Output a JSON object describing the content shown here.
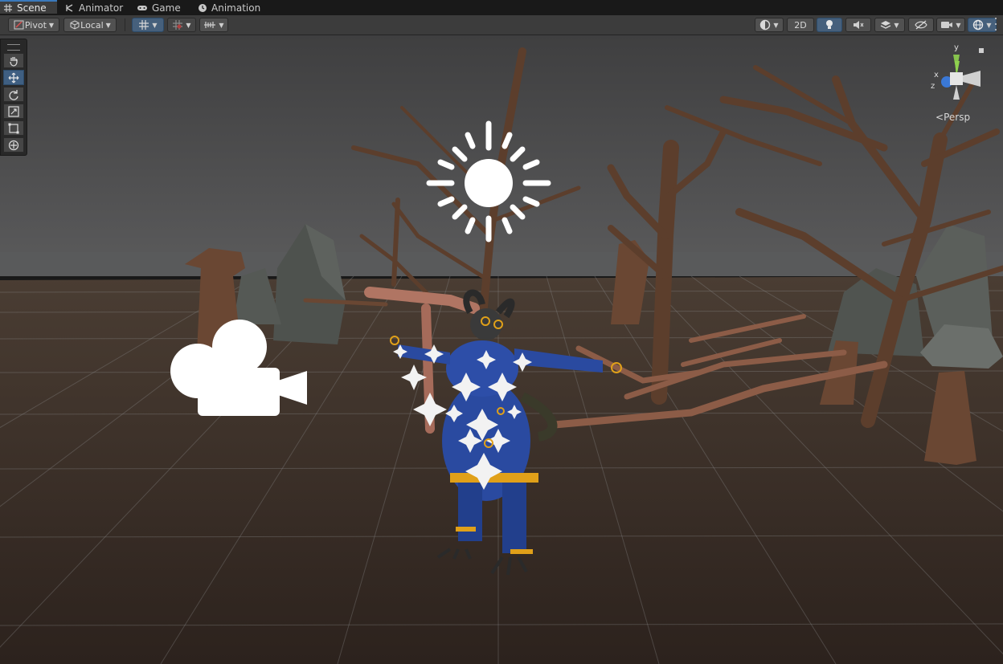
{
  "tabs": [
    {
      "label": "Scene",
      "icon": "grid-icon",
      "active": true
    },
    {
      "label": "Animator",
      "icon": "animator-icon",
      "active": false
    },
    {
      "label": "Game",
      "icon": "gamepad-icon",
      "active": false
    },
    {
      "label": "Animation",
      "icon": "clock-icon",
      "active": false
    }
  ],
  "toolbar": {
    "pivot_label": "Pivot",
    "local_label": "Local",
    "mode_2d_label": "2D",
    "more_icon": "vertical-ellipsis-icon"
  },
  "tools": [
    "hand-tool-icon",
    "move-tool-icon",
    "rotate-tool-icon",
    "scale-tool-icon",
    "rect-tool-icon",
    "transform-tool-icon"
  ],
  "gizmo": {
    "projection_label": "Persp",
    "axis_x": "x",
    "axis_y": "y",
    "axis_z": "z",
    "colors": {
      "x": "#e0533d",
      "y": "#8fd14f",
      "z": "#3a78d6"
    }
  },
  "scene": {
    "light_icon": "sun-icon",
    "camera_icon": "movie-camera-icon",
    "character_color": "#2a4aa0",
    "accent_color": "#e0a019"
  }
}
